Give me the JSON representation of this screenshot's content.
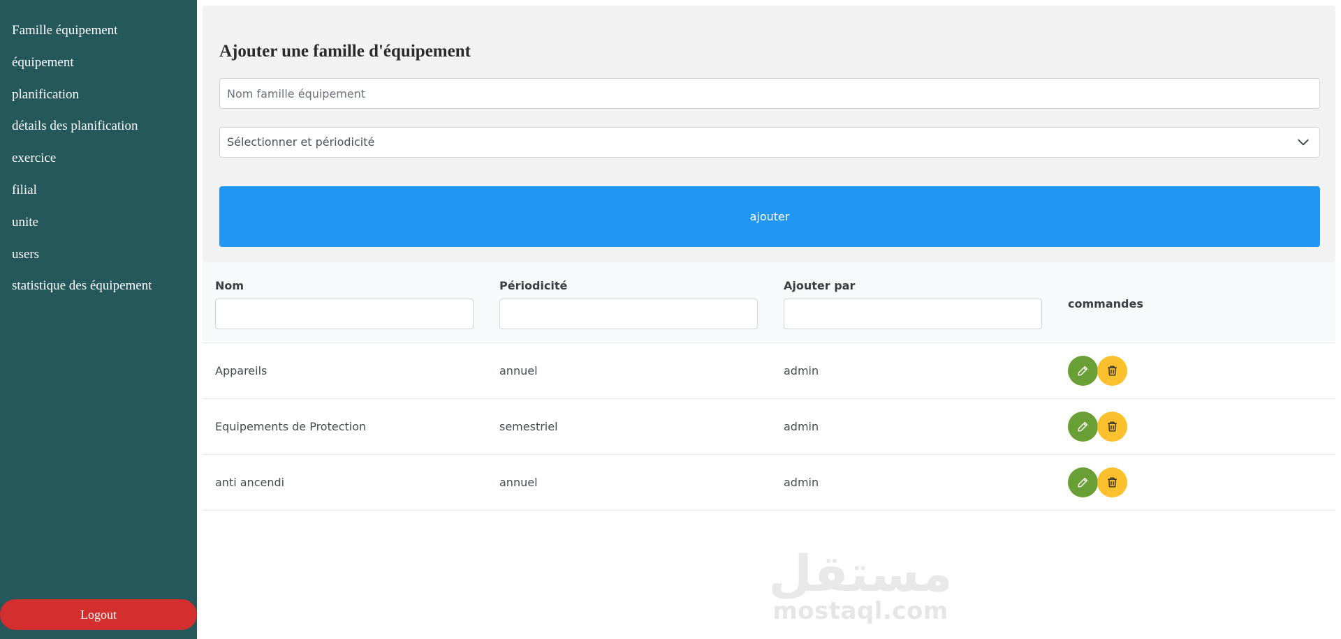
{
  "sidebar": {
    "items": [
      {
        "label": "Famille équipement"
      },
      {
        "label": "équipement"
      },
      {
        "label": "planification"
      },
      {
        "label": "détails des planification"
      },
      {
        "label": "exercice"
      },
      {
        "label": "filial"
      },
      {
        "label": "unite"
      },
      {
        "label": "users"
      },
      {
        "label": "statistique des équipement"
      }
    ],
    "logout_label": "Logout"
  },
  "form": {
    "title": "Ajouter une famille d'équipement",
    "name_placeholder": "Nom famille équipement",
    "select_value": "Sélectionner et périodicité",
    "submit_label": "ajouter"
  },
  "table": {
    "columns": {
      "nom": "Nom",
      "periodicite": "Périodicité",
      "ajouter_par": "Ajouter par",
      "commandes": "commandes"
    },
    "rows": [
      {
        "nom": "Appareils",
        "periodicite": "annuel",
        "ajouter_par": "admin"
      },
      {
        "nom": "Equipements de Protection",
        "periodicite": "semestriel",
        "ajouter_par": "admin"
      },
      {
        "nom": "anti ancendi",
        "periodicite": "annuel",
        "ajouter_par": "admin"
      }
    ]
  },
  "watermark": {
    "arabic": "مستقل",
    "latin": "mostaql.com"
  },
  "icons": {
    "edit": "pencil-icon",
    "delete": "trash-icon",
    "select": "chevron-down-icon"
  },
  "colors": {
    "sidebar": "#25585a",
    "primary": "#2196f3",
    "logout": "#d32f2f",
    "edit": "#6a9f35",
    "delete": "#fbc02d"
  }
}
